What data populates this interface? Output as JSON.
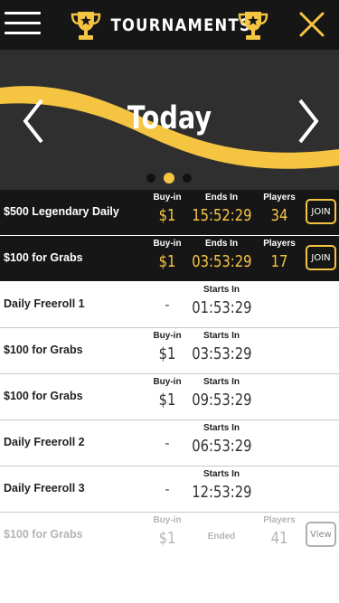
{
  "colors": {
    "accent": "#f5c542",
    "header_bg": "#161616",
    "banner_bg": "#2f2f2f",
    "ended_text": "#b5b5b5"
  },
  "header": {
    "title": "TOURNAMENTS",
    "menu_icon": "hamburger-menu-icon",
    "close_icon": "close-icon",
    "trophy_icon": "trophy-icon"
  },
  "carousel": {
    "title": "Today",
    "page_count": 3,
    "active_page": 2
  },
  "tournaments": [
    {
      "name": "$500 Legendary Daily",
      "featured": true,
      "buyin_label": "Buy-in",
      "buyin": "$1",
      "time_label": "Ends In",
      "time": "15:52:29",
      "players_label": "Players",
      "players": "34",
      "action": "JOIN"
    },
    {
      "name": "$100 for Grabs",
      "featured": true,
      "buyin_label": "Buy-in",
      "buyin": "$1",
      "time_label": "Ends In",
      "time": "03:53:29",
      "players_label": "Players",
      "players": "17",
      "action": "JOIN"
    },
    {
      "name": "Daily Freeroll 1",
      "buyin": "-",
      "time_label": "Starts In",
      "time": "01:53:29"
    },
    {
      "name": "$100 for Grabs",
      "buyin_label": "Buy-in",
      "buyin": "$1",
      "time_label": "Starts In",
      "time": "03:53:29"
    },
    {
      "name": "$100 for Grabs",
      "buyin_label": "Buy-in",
      "buyin": "$1",
      "time_label": "Starts In",
      "time": "09:53:29"
    },
    {
      "name": "Daily Freeroll 2",
      "buyin": "-",
      "time_label": "Starts In",
      "time": "06:53:29"
    },
    {
      "name": "Daily Freeroll 3",
      "buyin": "-",
      "time_label": "Starts In",
      "time": "12:53:29"
    },
    {
      "name": "$100 for Grabs",
      "ended": true,
      "buyin_label": "Buy-in",
      "buyin": "$1",
      "status": "Ended",
      "players_label": "Players",
      "players": "41",
      "action": "View"
    }
  ]
}
